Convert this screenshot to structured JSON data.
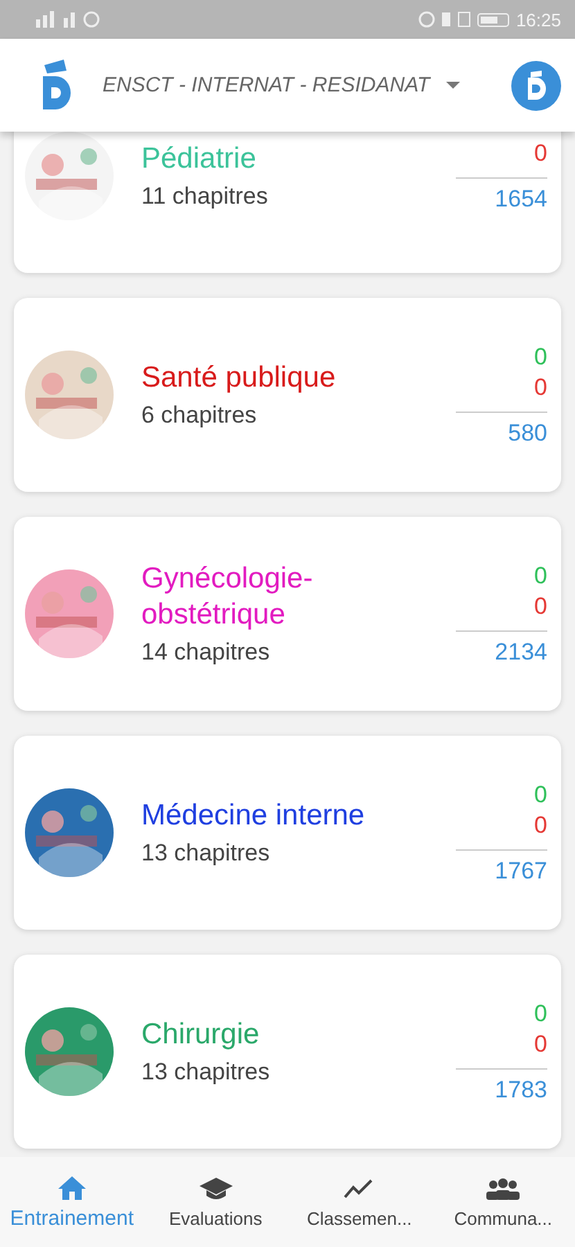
{
  "status_bar": {
    "time": "16:25"
  },
  "header": {
    "title": "ENSCT - INTERNAT - RESIDANAT"
  },
  "modules": [
    {
      "title": "Pédiatrie",
      "color": "#3cc39a",
      "chapters": "11 chapitres",
      "wrong": "0",
      "total": "1654"
    },
    {
      "title": "Santé publique",
      "color": "#d81b1b",
      "chapters": "6 chapitres",
      "correct": "0",
      "wrong": "0",
      "total": "580"
    },
    {
      "title": "Gynécologie-obstétrique",
      "color": "#e21bc0",
      "chapters": "14 chapitres",
      "correct": "0",
      "wrong": "0",
      "total": "2134"
    },
    {
      "title": "Médecine interne",
      "color": "#1f3fe0",
      "chapters": "13 chapitres",
      "correct": "0",
      "wrong": "0",
      "total": "1767"
    },
    {
      "title": "Chirurgie",
      "color": "#2aa86a",
      "chapters": "13 chapitres",
      "correct": "0",
      "wrong": "0",
      "total": "1783"
    }
  ],
  "nav": [
    {
      "kind": "home",
      "label": "Entrainement",
      "selected": true
    },
    {
      "kind": "cap",
      "label": "Evaluations",
      "selected": false
    },
    {
      "kind": "chart",
      "label": "Classemen...",
      "selected": false
    },
    {
      "kind": "group",
      "label": "Communa...",
      "selected": false
    }
  ]
}
